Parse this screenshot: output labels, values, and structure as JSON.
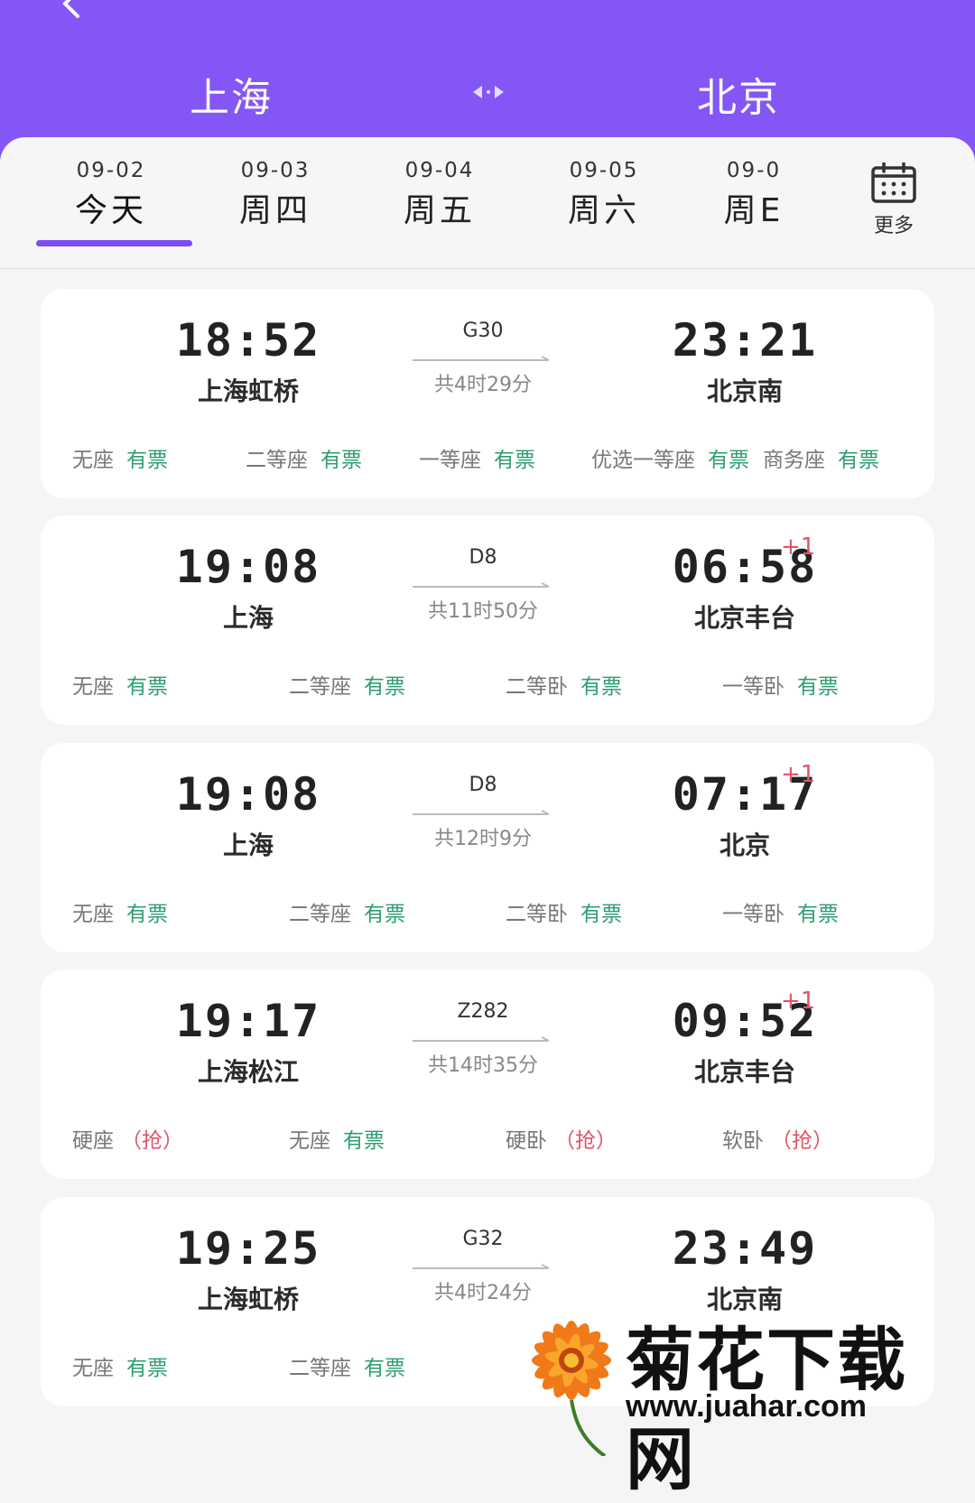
{
  "header": {
    "from_city": "上海",
    "to_city": "北京",
    "background": "#8456f6"
  },
  "dates": [
    {
      "date": "09-02",
      "weekday": "今天",
      "active": true
    },
    {
      "date": "09-03",
      "weekday": "周四"
    },
    {
      "date": "09-04",
      "weekday": "周五"
    },
    {
      "date": "09-05",
      "weekday": "周六"
    },
    {
      "date": "09-0",
      "weekday": "周E"
    }
  ],
  "more_label": "更多",
  "trains": [
    {
      "dep_time": "18:52",
      "dep_station": "上海虹桥",
      "train_no": "G30",
      "duration": "共4时29分",
      "arr_time": "23:21",
      "arr_station": "北京南",
      "plus_day": "",
      "seats": [
        {
          "name": "无座",
          "status": "有票"
        },
        {
          "name": "二等座",
          "status": "有票"
        },
        {
          "name": "一等座",
          "status": "有票"
        },
        {
          "name": "优选一等座",
          "status": "有票"
        },
        {
          "name": "商务座",
          "status": "有票"
        }
      ]
    },
    {
      "dep_time": "19:08",
      "dep_station": "上海",
      "train_no": "D8",
      "duration": "共11时50分",
      "arr_time": "06:58",
      "arr_station": "北京丰台",
      "plus_day": "+1",
      "seats": [
        {
          "name": "无座",
          "status": "有票"
        },
        {
          "name": "二等座",
          "status": "有票"
        },
        {
          "name": "二等卧",
          "status": "有票"
        },
        {
          "name": "一等卧",
          "status": "有票"
        }
      ]
    },
    {
      "dep_time": "19:08",
      "dep_station": "上海",
      "train_no": "D8",
      "duration": "共12时9分",
      "arr_time": "07:17",
      "arr_station": "北京",
      "plus_day": "+1",
      "seats": [
        {
          "name": "无座",
          "status": "有票"
        },
        {
          "name": "二等座",
          "status": "有票"
        },
        {
          "name": "二等卧",
          "status": "有票"
        },
        {
          "name": "一等卧",
          "status": "有票"
        }
      ]
    },
    {
      "dep_time": "19:17",
      "dep_station": "上海松江",
      "train_no": "Z282",
      "duration": "共14时35分",
      "arr_time": "09:52",
      "arr_station": "北京丰台",
      "plus_day": "+1",
      "seats": [
        {
          "name": "硬座",
          "status": "（抢）"
        },
        {
          "name": "无座",
          "status": "有票"
        },
        {
          "name": "硬卧",
          "status": "（抢）"
        },
        {
          "name": "软卧",
          "status": "（抢）"
        }
      ]
    },
    {
      "dep_time": "19:25",
      "dep_station": "上海虹桥",
      "train_no": "G32",
      "duration": "共4时24分",
      "arr_time": "23:49",
      "arr_station": "北京南",
      "plus_day": "",
      "seats": [
        {
          "name": "无座",
          "status": "有票"
        },
        {
          "name": "二等座",
          "status": "有票"
        }
      ]
    }
  ],
  "colors": {
    "accent": "#7a4df2",
    "available": "#2e9e6f",
    "grab": "#e0556a"
  },
  "watermark": {
    "title": "菊花下载网",
    "url": "www.juahar.com"
  }
}
